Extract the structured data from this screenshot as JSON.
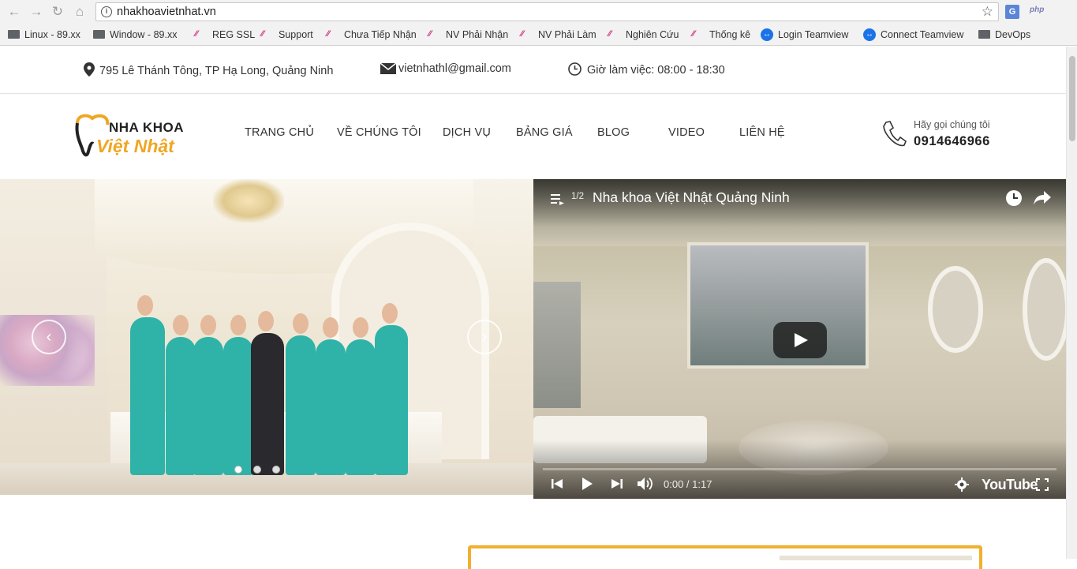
{
  "browser": {
    "url": "nhakhoavietnhat.vn",
    "ext_icons": [
      "translate-icon",
      "php-icon"
    ],
    "ext_php_label": "php",
    "ext_translate_label": "G"
  },
  "bookmarks": [
    {
      "label": "Linux - 89.xx",
      "icon": "folder"
    },
    {
      "label": "Window - 89.xx",
      "icon": "folder"
    },
    {
      "label": "REG SSL",
      "icon": "mark"
    },
    {
      "label": "Support",
      "icon": "mark"
    },
    {
      "label": "Chưa Tiếp Nhận",
      "icon": "mark"
    },
    {
      "label": "NV Phải Nhận",
      "icon": "mark"
    },
    {
      "label": "NV Phải Làm",
      "icon": "mark"
    },
    {
      "label": "Nghiên Cứu",
      "icon": "mark"
    },
    {
      "label": "Thống kê",
      "icon": "mark"
    },
    {
      "label": "Login Teamview",
      "icon": "teamviewer"
    },
    {
      "label": "Connect Teamview",
      "icon": "teamviewer"
    },
    {
      "label": "DevOps",
      "icon": "folder"
    }
  ],
  "topbar": {
    "address": "795 Lê Thánh Tông, TP Hạ Long, Quảng Ninh",
    "email": "vietnhathl@gmail.com",
    "hours": "Giờ làm việc: 08:00 - 18:30"
  },
  "logo": {
    "line1": "NHA KHOA",
    "line2": "Việt Nhật"
  },
  "nav": [
    {
      "label": "TRANG CHỦ"
    },
    {
      "label": "VỀ CHÚNG TÔI"
    },
    {
      "label": "DỊCH VỤ"
    },
    {
      "label": "BẢNG GIÁ"
    },
    {
      "label": "BLOG"
    },
    {
      "label": "VIDEO"
    },
    {
      "label": "LIÊN HỆ"
    }
  ],
  "contact": {
    "label": "Hãy gọi chúng tôi",
    "phone": "0914646966"
  },
  "slider": {
    "dots": 3,
    "active_dot": 0,
    "prev_arrow": "‹",
    "next_arrow": "›"
  },
  "video": {
    "playlist_counter": "1/2",
    "title": "Nha khoa Việt Nhật Quảng Ninh",
    "time": "0:00 / 1:17",
    "brand": "YouTube"
  },
  "colors": {
    "accent": "#f0a623",
    "teal": "#2fb3a8",
    "bookmark_mark": "#d12a7a"
  }
}
